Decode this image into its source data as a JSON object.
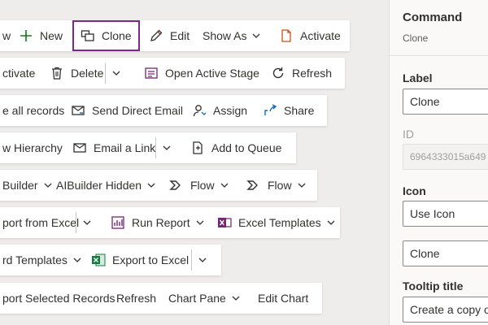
{
  "rows": [
    [
      {
        "label": "w",
        "icon": "none",
        "chevron": false
      },
      {
        "label": "New",
        "icon": "plus-icon",
        "chevron": false
      },
      {
        "label": "Clone",
        "icon": "clone-icon",
        "chevron": false,
        "selected": true
      },
      {
        "label": "Edit",
        "icon": "pencil-icon",
        "chevron": false
      },
      {
        "label": "Show As",
        "icon": "none",
        "chevron": true
      },
      {
        "label": "Activate",
        "icon": "document-icon",
        "chevron": false
      }
    ],
    [
      {
        "label": "ctivate",
        "icon": "none",
        "chevron": false
      },
      {
        "label": "Delete",
        "icon": "trash-icon",
        "chevron": false
      },
      {
        "label": "",
        "icon": "split-chevron",
        "chevron": false
      },
      {
        "label": "Open Active Stage",
        "icon": "stage-icon",
        "chevron": false
      },
      {
        "label": "Refresh",
        "icon": "refresh-icon",
        "chevron": false
      }
    ],
    [
      {
        "label": "e all records",
        "icon": "none",
        "chevron": false
      },
      {
        "label": "Send Direct Email",
        "icon": "email-icon",
        "chevron": false
      },
      {
        "label": "Assign",
        "icon": "person-icon",
        "chevron": false
      },
      {
        "label": "Share",
        "icon": "share-icon",
        "chevron": false
      }
    ],
    [
      {
        "label": "w Hierarchy",
        "icon": "none",
        "chevron": false
      },
      {
        "label": "Email a Link",
        "icon": "email-link-icon",
        "chevron": false
      },
      {
        "label": "",
        "icon": "split-chevron",
        "chevron": false
      },
      {
        "label": "Add to Queue",
        "icon": "queue-icon",
        "chevron": false
      }
    ],
    [
      {
        "label": "Builder",
        "icon": "none",
        "chevron": true
      },
      {
        "label": "AIBuilder Hidden",
        "icon": "none",
        "chevron": true
      },
      {
        "label": "Flow",
        "icon": "flow-icon",
        "chevron": true
      },
      {
        "label": "Flow",
        "icon": "flow-icon",
        "chevron": true
      }
    ],
    [
      {
        "label": "port from Excel",
        "icon": "none",
        "chevron": false
      },
      {
        "label": "",
        "icon": "split-chevron",
        "chevron": false
      },
      {
        "label": "Run Report",
        "icon": "report-icon",
        "chevron": true
      },
      {
        "label": "Excel Templates",
        "icon": "excel-template-icon",
        "chevron": true
      }
    ],
    [
      {
        "label": "rd Templates",
        "icon": "none",
        "chevron": true
      },
      {
        "label": "Export to Excel",
        "icon": "excel-icon",
        "chevron": false
      },
      {
        "label": "",
        "icon": "split-chevron",
        "chevron": false
      }
    ],
    [
      {
        "label": "port Selected Records",
        "icon": "none",
        "chevron": false
      },
      {
        "label": "Refresh",
        "icon": "none",
        "chevron": false
      },
      {
        "label": "Chart Pane",
        "icon": "none",
        "chevron": true
      },
      {
        "label": "Edit Chart",
        "icon": "none",
        "chevron": false
      }
    ]
  ],
  "panel": {
    "title": "Command",
    "subtitle": "Clone",
    "label_heading": "Label",
    "label_value": "Clone",
    "id_heading": "ID",
    "id_value": "6964333015a649",
    "icon_heading": "Icon",
    "icon_select": "Use Icon",
    "icon_value": "Clone",
    "tooltip_heading": "Tooltip title",
    "tooltip_value": "Create a copy of"
  },
  "colors": {
    "selected_outline": "#7a2a86",
    "accent_blue": "#0f6cbd",
    "excel_green": "#107c41",
    "flow_purple": "#742774"
  }
}
